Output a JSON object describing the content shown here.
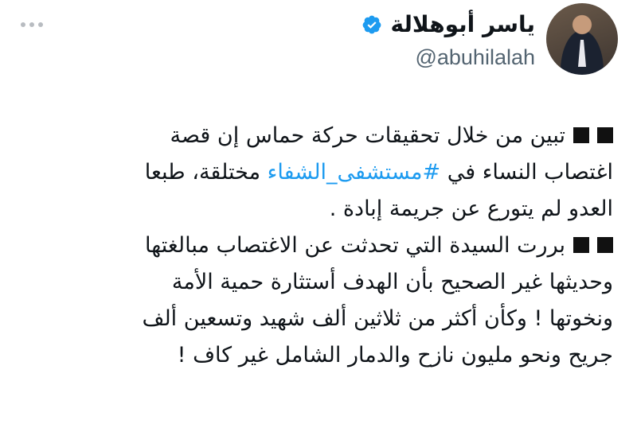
{
  "author": {
    "display_name": "ياسر أبوهلالة",
    "handle": "@abuhilalah",
    "verified_icon": "verified-badge-icon",
    "avatar_icon": "avatar-photo"
  },
  "menu": {
    "icon": "more-horizontal-icon"
  },
  "tweet": {
    "line1_text": "تبين من خلال تحقيقات حركة حماس إن قصة",
    "line2_pre": "اغتصاب النساء في ",
    "hashtag": "#مستشفى_الشفاء",
    "line2_post": " مختلقة، طبعا",
    "line3_text": "العدو لم يتورع عن جريمة إبادة .",
    "line4_text": "بررت السيدة التي تحدثت عن الاغتصاب مبالغتها",
    "line5_text": "وحديثها غير الصحيح بأن الهدف أستثارة حمية الأمة",
    "line6_text": "ونخوتها ! وكأن أكثر من ثلاثين ألف شهيد وتسعين ألف",
    "line7_text": "جريح ونحو مليون نازح والدمار الشامل غير كاف !"
  },
  "colors": {
    "link": "#1d9bf0",
    "verified": "#1d9bf0",
    "text": "#0f1419",
    "muted": "#536471"
  }
}
